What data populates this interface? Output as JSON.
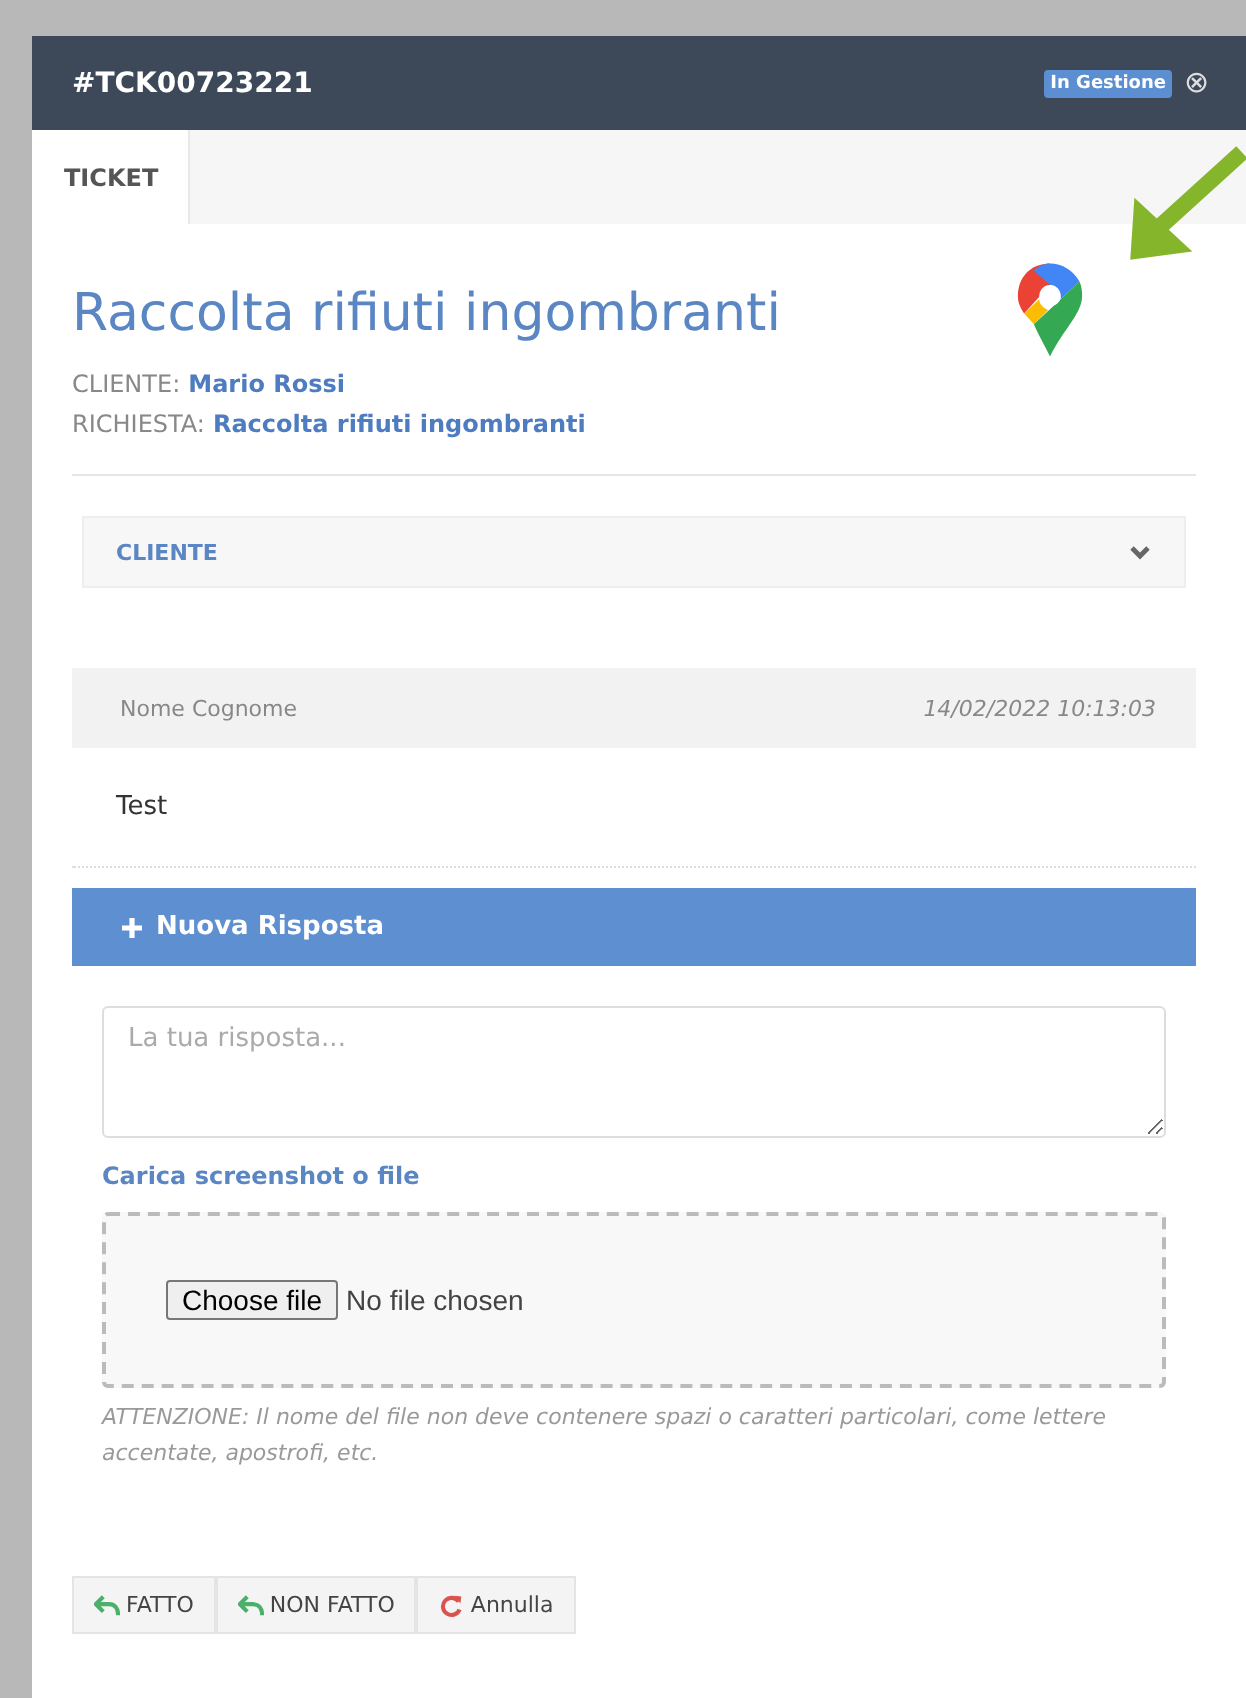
{
  "window": {
    "title": "#TCK00723221",
    "status": "In Gestione",
    "close": "⊗"
  },
  "tabs": [
    {
      "label": "TICKET",
      "selected": true
    }
  ],
  "ticket": {
    "title": "Raccolta rifiuti ingombranti",
    "fields": [
      {
        "label": "CLIENTE:",
        "value": "Mario Rossi"
      },
      {
        "label": "RICHIESTA:",
        "value": "Raccolta rifiuti ingombranti"
      }
    ]
  },
  "sections": [
    {
      "label": "CLIENTE",
      "expanded": false
    }
  ],
  "messages": [
    {
      "author": "Nome Cognome",
      "time": "14/02/2022 10:13:03",
      "body": "Test"
    }
  ],
  "reply": {
    "header": "Nuova Risposta",
    "placeholder": "La tua risposta...",
    "upload_label": "Carica screenshot o file",
    "file_button": "Choose file",
    "file_status": "No file chosen",
    "warning": "ATTENZIONE: Il nome del file non deve contenere spazi o caratteri particolari, come lettere accentate, apostrofi, etc."
  },
  "buttons": [
    {
      "label": "FATTO",
      "kind": "reply"
    },
    {
      "label": "NON FATTO",
      "kind": "reply"
    },
    {
      "label": "Annulla",
      "kind": "cancel"
    }
  ]
}
